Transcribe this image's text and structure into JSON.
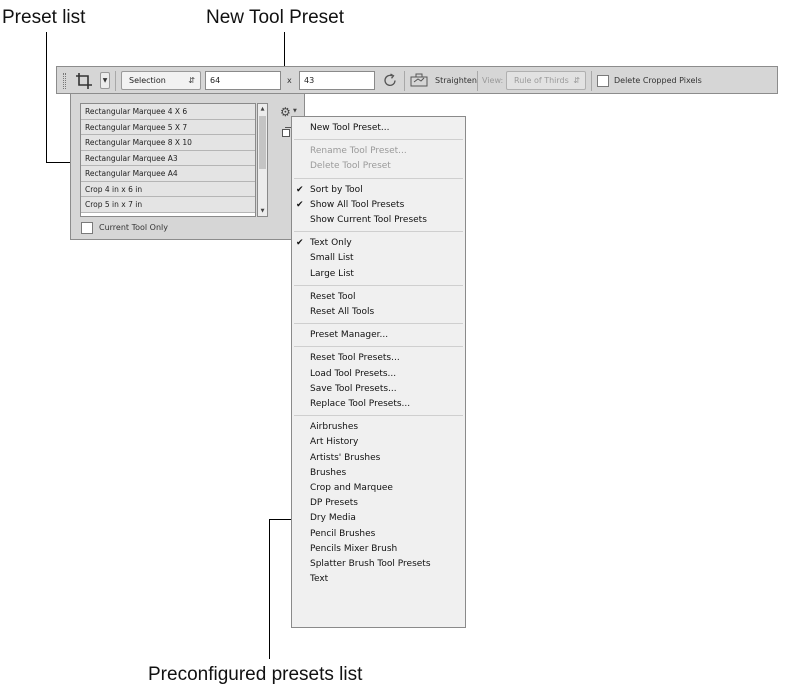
{
  "callouts": {
    "preset_list": "Preset list",
    "new_tool_preset": "New Tool Preset",
    "preconfigured": "Preconfigured presets list"
  },
  "options_bar": {
    "ratio_select": "Selection",
    "width_value": "64",
    "times": "x",
    "height_value": "43",
    "straighten": "Straighten",
    "view_label": "View:",
    "view_select": "Rule of Thirds",
    "delete_cropped": "Delete Cropped Pixels"
  },
  "presets_panel": {
    "items": [
      "Rectangular Marquee 4 X 6",
      "Rectangular Marquee 5 X 7",
      "Rectangular Marquee 8 X 10",
      "Rectangular Marquee A3",
      "Rectangular Marquee A4",
      "Crop 4 in x 6 in",
      "Crop 5 in x 7 in"
    ],
    "current_tool_only": "Current Tool Only"
  },
  "menu": {
    "items": [
      {
        "label": "New Tool Preset...",
        "enabled": true,
        "checked": false
      },
      {
        "label": "Rename Tool Preset...",
        "enabled": false,
        "checked": false
      },
      {
        "label": "Delete Tool Preset",
        "enabled": false,
        "checked": false
      },
      {
        "label": "Sort by Tool",
        "enabled": true,
        "checked": true
      },
      {
        "label": "Show All Tool Presets",
        "enabled": true,
        "checked": true
      },
      {
        "label": "Show Current Tool Presets",
        "enabled": true,
        "checked": false
      },
      {
        "label": "Text Only",
        "enabled": true,
        "checked": true
      },
      {
        "label": "Small List",
        "enabled": true,
        "checked": false
      },
      {
        "label": "Large List",
        "enabled": true,
        "checked": false
      },
      {
        "label": "Reset Tool",
        "enabled": true,
        "checked": false
      },
      {
        "label": "Reset All Tools",
        "enabled": true,
        "checked": false
      },
      {
        "label": "Preset Manager...",
        "enabled": true,
        "checked": false
      },
      {
        "label": "Reset Tool Presets...",
        "enabled": true,
        "checked": false
      },
      {
        "label": "Load Tool Presets...",
        "enabled": true,
        "checked": false
      },
      {
        "label": "Save Tool Presets...",
        "enabled": true,
        "checked": false
      },
      {
        "label": "Replace Tool Presets...",
        "enabled": true,
        "checked": false
      },
      {
        "label": "Airbrushes",
        "enabled": true,
        "checked": false
      },
      {
        "label": "Art History",
        "enabled": true,
        "checked": false
      },
      {
        "label": "Artists' Brushes",
        "enabled": true,
        "checked": false
      },
      {
        "label": "Brushes",
        "enabled": true,
        "checked": false
      },
      {
        "label": "Crop and Marquee",
        "enabled": true,
        "checked": false
      },
      {
        "label": "DP Presets",
        "enabled": true,
        "checked": false
      },
      {
        "label": "Dry Media",
        "enabled": true,
        "checked": false
      },
      {
        "label": "Pencil Brushes",
        "enabled": true,
        "checked": false
      },
      {
        "label": "Pencils Mixer Brush",
        "enabled": true,
        "checked": false
      },
      {
        "label": "Splatter Brush Tool Presets",
        "enabled": true,
        "checked": false
      },
      {
        "label": "Text",
        "enabled": true,
        "checked": false
      }
    ]
  },
  "icons": {
    "crop_tool": "crop-icon",
    "rotate": "rotate-icon",
    "straighten": "straighten-icon",
    "gear": "gear-icon",
    "new_preset": "new-preset-icon",
    "check": "checkmark-icon"
  }
}
